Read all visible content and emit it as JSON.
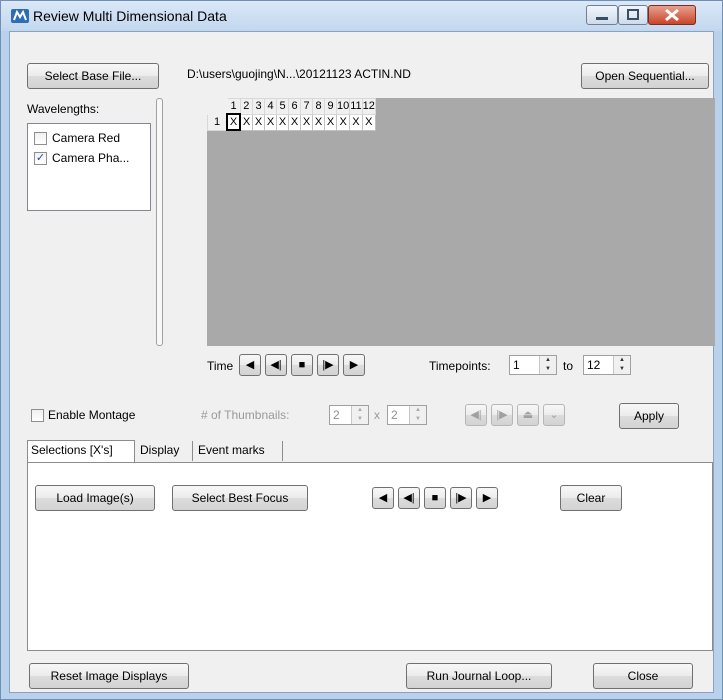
{
  "window": {
    "title": "Review Multi Dimensional Data",
    "controls": [
      "minimize-icon",
      "maximize-icon",
      "close-icon"
    ]
  },
  "top": {
    "select_base_file": "Select Base File...",
    "file_path": "D:\\users\\guojing\\N...\\20121123 ACTIN.ND",
    "open_sequential": "Open Sequential..."
  },
  "wavelengths": {
    "label": "Wavelengths:",
    "items": [
      {
        "label": "Camera Red",
        "checked": false
      },
      {
        "label": "Camera Pha...",
        "checked": true
      }
    ]
  },
  "grid": {
    "columns": [
      "1",
      "2",
      "3",
      "4",
      "5",
      "6",
      "7",
      "8",
      "9",
      "10",
      "11",
      "12"
    ],
    "rows": [
      {
        "label": "1",
        "cells": [
          "X",
          "X",
          "X",
          "X",
          "X",
          "X",
          "X",
          "X",
          "X",
          "X",
          "X",
          "X"
        ]
      }
    ],
    "selected_cell": "1"
  },
  "playback": {
    "time_label": "Time",
    "buttons": [
      "◀",
      "◀|",
      "■",
      "|▶",
      "▶"
    ],
    "timepoints_label": "Timepoints:",
    "from_value": "1",
    "to_label": "to",
    "to_value": "12"
  },
  "montage": {
    "enable_label": "Enable Montage",
    "thumbnails_label": "# of Thumbnails:",
    "cols_value": "2",
    "times_sign": "x",
    "rows_value": "2",
    "apply_label": "Apply"
  },
  "tabs": [
    {
      "label": "Selections [X's]",
      "active": true
    },
    {
      "label": "Display",
      "active": false
    },
    {
      "label": "Event marks",
      "active": false
    }
  ],
  "selections_panel": {
    "load_images": "Load Image(s)",
    "select_best_focus": "Select Best Focus",
    "clear": "Clear"
  },
  "bottom": {
    "reset_image_displays": "Reset Image Displays",
    "run_journal_loop": "Run Journal Loop...",
    "close": "Close"
  }
}
